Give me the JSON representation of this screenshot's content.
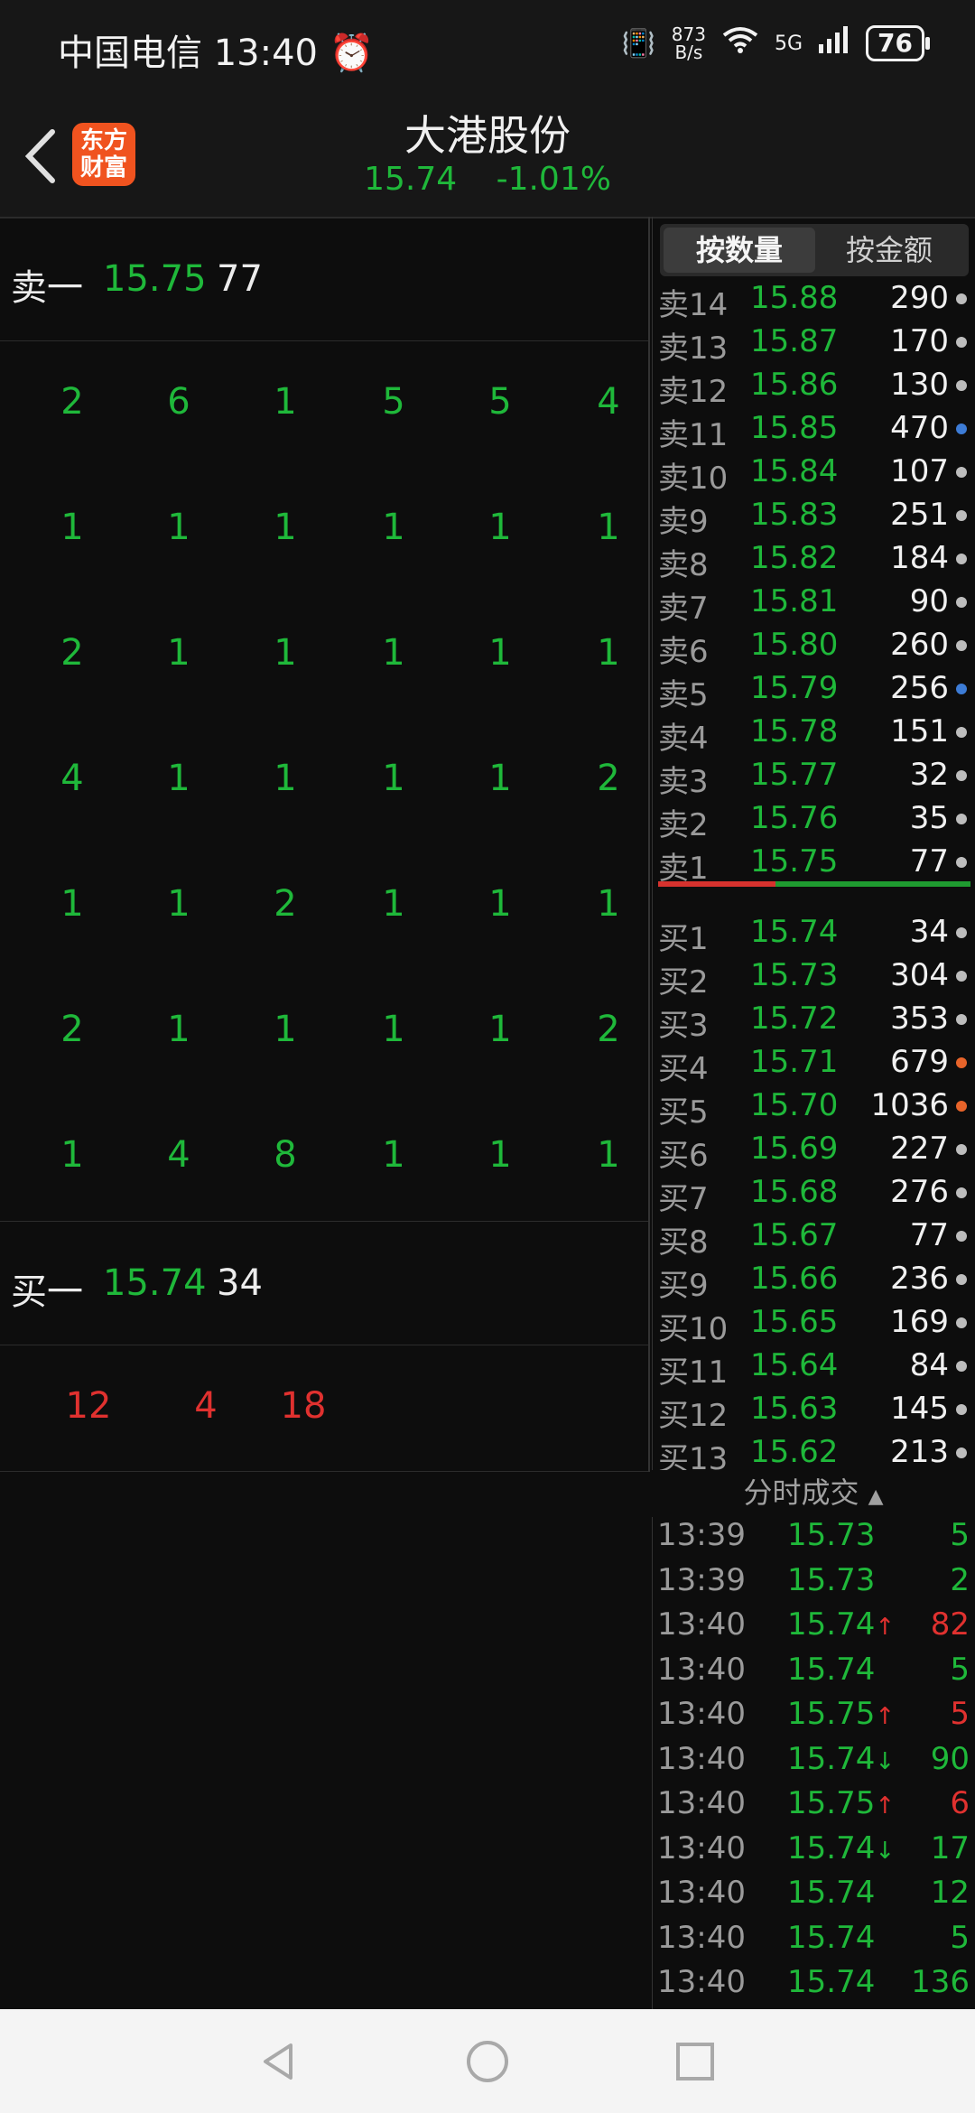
{
  "status_bar": {
    "carrier": "中国电信",
    "time": "13:40",
    "net_speed_value": "873",
    "net_speed_unit": "B/s",
    "network": "5G",
    "battery": "76"
  },
  "header": {
    "stock_name": "大港股份",
    "price": "15.74",
    "change_pct": "-1.01%",
    "logo_text_line1": "东方",
    "logo_text_line2": "财富"
  },
  "left_panel": {
    "sell_level": {
      "label": "卖一",
      "price": "15.75",
      "volume": "77"
    },
    "sell_orders": [
      [
        "2",
        "6",
        "1",
        "5",
        "5",
        "4"
      ],
      [
        "1",
        "1",
        "1",
        "1",
        "1",
        "1"
      ],
      [
        "2",
        "1",
        "1",
        "1",
        "1",
        "1"
      ],
      [
        "4",
        "1",
        "1",
        "1",
        "1",
        "2"
      ],
      [
        "1",
        "1",
        "2",
        "1",
        "1",
        "1"
      ],
      [
        "2",
        "1",
        "1",
        "1",
        "1",
        "2"
      ],
      [
        "1",
        "4",
        "8",
        "1",
        "1",
        "1"
      ]
    ],
    "buy_level": {
      "label": "买一",
      "price": "15.74",
      "volume": "34"
    },
    "buy_orders": [
      "12",
      "4",
      "18"
    ]
  },
  "depth": {
    "tabs": [
      "按数量",
      "按金额"
    ],
    "active_tab": "按数量",
    "rows": [
      {
        "label": "卖14",
        "price": "15.88",
        "volume": "290",
        "dot": "#bdbdbd"
      },
      {
        "label": "卖13",
        "price": "15.87",
        "volume": "170",
        "dot": "#bdbdbd"
      },
      {
        "label": "卖12",
        "price": "15.86",
        "volume": "130",
        "dot": "#bdbdbd"
      },
      {
        "label": "卖11",
        "price": "15.85",
        "volume": "470",
        "dot": "#3d7cd6"
      },
      {
        "label": "卖10",
        "price": "15.84",
        "volume": "107",
        "dot": "#bdbdbd"
      },
      {
        "label": "卖9",
        "price": "15.83",
        "volume": "251",
        "dot": "#bdbdbd"
      },
      {
        "label": "卖8",
        "price": "15.82",
        "volume": "184",
        "dot": "#bdbdbd"
      },
      {
        "label": "卖7",
        "price": "15.81",
        "volume": "90",
        "dot": "#bdbdbd"
      },
      {
        "label": "卖6",
        "price": "15.80",
        "volume": "260",
        "dot": "#bdbdbd"
      },
      {
        "label": "卖5",
        "price": "15.79",
        "volume": "256",
        "dot": "#3d7cd6"
      },
      {
        "label": "卖4",
        "price": "15.78",
        "volume": "151",
        "dot": "#bdbdbd"
      },
      {
        "label": "卖3",
        "price": "15.77",
        "volume": "32",
        "dot": "#bdbdbd"
      },
      {
        "label": "卖2",
        "price": "15.76",
        "volume": "35",
        "dot": "#bdbdbd"
      },
      {
        "label": "卖1",
        "price": "15.75",
        "volume": "77",
        "dot": "#bdbdbd"
      },
      {
        "label": "买1",
        "price": "15.74",
        "volume": "34",
        "dot": "#bdbdbd"
      },
      {
        "label": "买2",
        "price": "15.73",
        "volume": "304",
        "dot": "#bdbdbd"
      },
      {
        "label": "买3",
        "price": "15.72",
        "volume": "353",
        "dot": "#bdbdbd"
      },
      {
        "label": "买4",
        "price": "15.71",
        "volume": "679",
        "dot": "#e8642a"
      },
      {
        "label": "买5",
        "price": "15.70",
        "volume": "1036",
        "dot": "#e8642a"
      },
      {
        "label": "买6",
        "price": "15.69",
        "volume": "227",
        "dot": "#bdbdbd"
      },
      {
        "label": "买7",
        "price": "15.68",
        "volume": "276",
        "dot": "#bdbdbd"
      },
      {
        "label": "买8",
        "price": "15.67",
        "volume": "77",
        "dot": "#bdbdbd"
      },
      {
        "label": "买9",
        "price": "15.66",
        "volume": "236",
        "dot": "#bdbdbd"
      },
      {
        "label": "买10",
        "price": "15.65",
        "volume": "169",
        "dot": "#bdbdbd"
      },
      {
        "label": "买11",
        "price": "15.64",
        "volume": "84",
        "dot": "#bdbdbd"
      },
      {
        "label": "买12",
        "price": "15.63",
        "volume": "145",
        "dot": "#bdbdbd"
      },
      {
        "label": "买13",
        "price": "15.62",
        "volume": "213",
        "dot": "#bdbdbd"
      }
    ]
  },
  "ticks": {
    "title": "分时成交",
    "rows": [
      {
        "time": "13:39",
        "price": "15.73",
        "arrow": "",
        "volume": "5",
        "vol_color": "green"
      },
      {
        "time": "13:39",
        "price": "15.73",
        "arrow": "",
        "volume": "2",
        "vol_color": "green"
      },
      {
        "time": "13:40",
        "price": "15.74",
        "arrow": "↑",
        "volume": "82",
        "vol_color": "red"
      },
      {
        "time": "13:40",
        "price": "15.74",
        "arrow": "",
        "volume": "5",
        "vol_color": "green"
      },
      {
        "time": "13:40",
        "price": "15.75",
        "arrow": "↑",
        "volume": "5",
        "vol_color": "red"
      },
      {
        "time": "13:40",
        "price": "15.74",
        "arrow": "↓",
        "volume": "90",
        "vol_color": "green"
      },
      {
        "time": "13:40",
        "price": "15.75",
        "arrow": "↑",
        "volume": "6",
        "vol_color": "red"
      },
      {
        "time": "13:40",
        "price": "15.74",
        "arrow": "↓",
        "volume": "17",
        "vol_color": "green"
      },
      {
        "time": "13:40",
        "price": "15.74",
        "arrow": "",
        "volume": "12",
        "vol_color": "green"
      },
      {
        "time": "13:40",
        "price": "15.74",
        "arrow": "",
        "volume": "5",
        "vol_color": "green"
      },
      {
        "time": "13:40",
        "price": "15.74",
        "arrow": "",
        "volume": "136",
        "vol_color": "green"
      }
    ]
  },
  "nav": {
    "icons": [
      "back-nav-icon",
      "home-nav-icon",
      "recents-nav-icon"
    ]
  }
}
